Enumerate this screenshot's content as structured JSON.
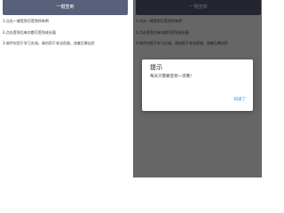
{
  "sign_button_label": "一键签到",
  "instructions": [
    "1.点击一键签到可签到所有吧",
    "2.点击签到后每次都可签到成长值",
    "3.软件仅用于学习交流，请勿用于非法用途，违者后果自负"
  ],
  "dialog": {
    "title": "提示",
    "message": "每天只需要签到一次哦！",
    "confirm_label": "知道了"
  },
  "colors": {
    "button_bg": "#58607a",
    "overlay": "rgba(0,0,0,0.6)",
    "link_blue": "#3a8fd6"
  }
}
